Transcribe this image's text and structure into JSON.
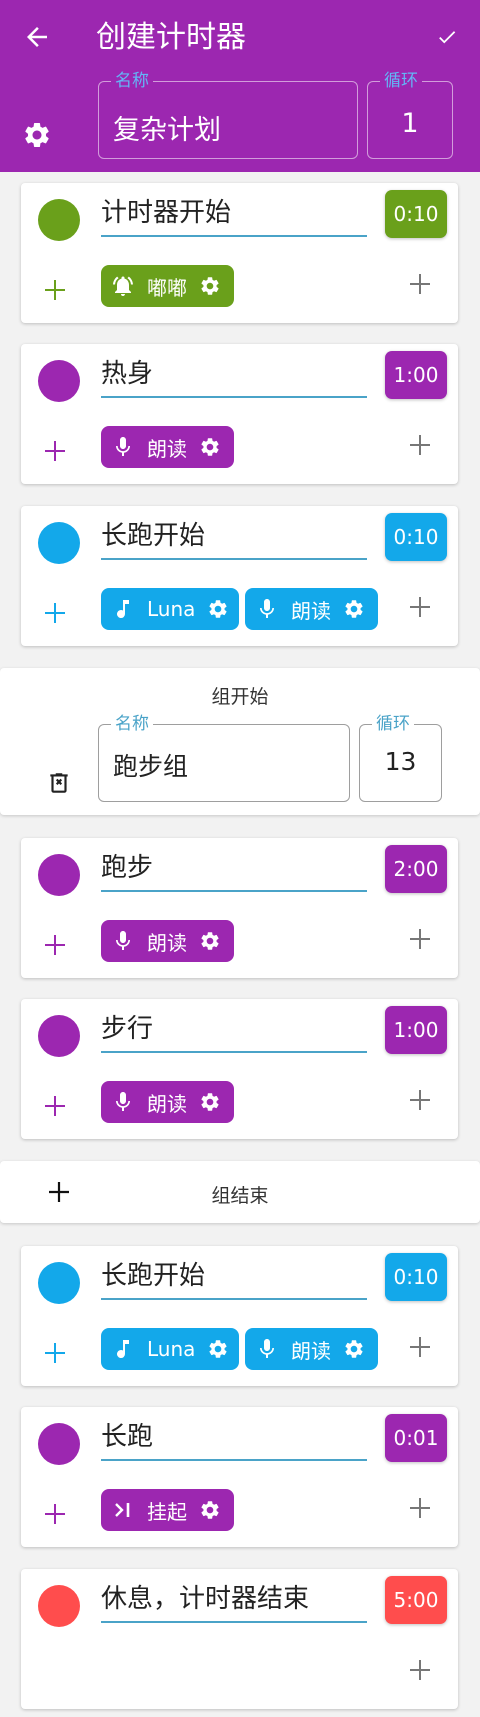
{
  "appbar": {
    "title": "创建计时器",
    "name_label": "名称",
    "name_value": "复杂计划",
    "loop_label": "循环",
    "loop_value": "1"
  },
  "colors": {
    "appbar": "#9c27b0",
    "green": "#6aa01b",
    "purple": "#9c27b0",
    "blue": "#13a8ea",
    "red": "#ff4d4d"
  },
  "timers": [
    {
      "name": "计时器开始",
      "duration": "0:10",
      "color": "green",
      "chips": [
        {
          "icon": "bell-icon",
          "label": "嘟嘟"
        }
      ]
    },
    {
      "name": "热身",
      "duration": "1:00",
      "color": "purple",
      "chips": [
        {
          "icon": "mic-icon",
          "label": "朗读"
        }
      ]
    },
    {
      "name": "长跑开始",
      "duration": "0:10",
      "color": "blue",
      "chips": [
        {
          "icon": "music-note-icon",
          "label": "Luna"
        },
        {
          "icon": "mic-icon",
          "label": "朗读"
        }
      ]
    },
    {
      "name": "跑步",
      "duration": "2:00",
      "color": "purple",
      "chips": [
        {
          "icon": "mic-icon",
          "label": "朗读"
        }
      ]
    },
    {
      "name": "步行",
      "duration": "1:00",
      "color": "purple",
      "chips": [
        {
          "icon": "mic-icon",
          "label": "朗读"
        }
      ]
    },
    {
      "name": "长跑开始",
      "duration": "0:10",
      "color": "blue",
      "chips": [
        {
          "icon": "music-note-icon",
          "label": "Luna"
        },
        {
          "icon": "mic-icon",
          "label": "朗读"
        }
      ]
    },
    {
      "name": "长跑",
      "duration": "0:01",
      "color": "purple",
      "chips": [
        {
          "icon": "skip-icon",
          "label": "挂起"
        }
      ]
    },
    {
      "name": "休息，计时器结束",
      "duration": "5:00",
      "color": "red",
      "chips": []
    }
  ],
  "group_start": {
    "title": "组开始",
    "name_label": "名称",
    "name_value": "跑步组",
    "loop_label": "循环",
    "loop_value": "13"
  },
  "group_end": {
    "title": "组结束"
  }
}
